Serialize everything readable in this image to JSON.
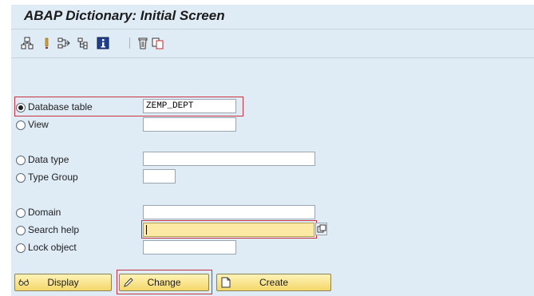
{
  "header": {
    "title": "ABAP Dictionary: Initial Screen"
  },
  "toolbar": {
    "icons": [
      "other-object-icon",
      "where-used-icon",
      "navigate-icon",
      "display-object-list-icon",
      "info-icon",
      "delete-icon",
      "copy-icon"
    ]
  },
  "form": {
    "database_table": {
      "label": "Database table",
      "value": "ZEMP_DEPT",
      "selected": true
    },
    "view": {
      "label": "View",
      "value": ""
    },
    "data_type": {
      "label": "Data type",
      "value": ""
    },
    "type_group": {
      "label": "Type Group",
      "value": ""
    },
    "domain": {
      "label": "Domain",
      "value": ""
    },
    "search_help": {
      "label": "Search help",
      "value": ""
    },
    "lock_object": {
      "label": "Lock object",
      "value": ""
    }
  },
  "buttons": {
    "display": "Display",
    "change": "Change",
    "create": "Create"
  },
  "colors": {
    "background": "#dfebf5",
    "highlight": "#c8313f",
    "active_field": "#fbe9a4",
    "button": "#f4d86b"
  }
}
